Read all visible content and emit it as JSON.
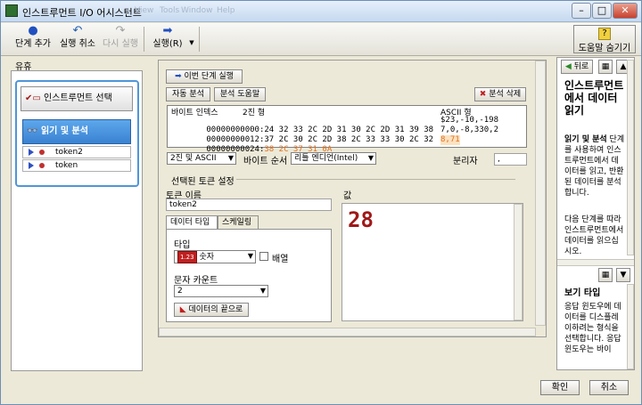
{
  "window": {
    "title": "인스트루먼트 I/O 어시스턴트",
    "ghost_menu": [
      "View",
      "Tools",
      "Window",
      "Help"
    ]
  },
  "toolbar": {
    "add_step": "단계 추가",
    "undo": "실행 취소",
    "redo": "다시 실행",
    "run": "실행(R)",
    "hide_help": "도움말 숨기기"
  },
  "left": {
    "label": "유휴",
    "step1": "인스트루먼트 선택",
    "step2": "읽기 및 분석",
    "tokens": [
      "token2",
      "token"
    ]
  },
  "main": {
    "run_prev": "이번 단계 실행",
    "auto_parse": "자동 분석",
    "parse_help": "분석 도움말",
    "delete_parse": "분석 삭제",
    "hex": {
      "col_index": "바이트 인덱스",
      "col_binary": "2진 형",
      "col_ascii": "ASCII 형",
      "rows": [
        {
          "index": "00000000000:",
          "hex": "24 32 33 2C 2D 31 30 2C 2D 31 39 38",
          "ascii": "$23,-10,-198"
        },
        {
          "index": "00000000012:",
          "hex": "37 2C 30 2C 2D 38 2C 33 33 30 2C 32",
          "ascii": "7,0,-8,330,2"
        },
        {
          "index": "00000000024:",
          "hex": "38 2C 37 31 0A",
          "ascii": "8,71"
        }
      ]
    },
    "display_mode": "2진 및 ASCII",
    "byte_order_label": "바이트 순서",
    "byte_order": "리틀 엔디언(Intel)",
    "separator_label": "분리자",
    "separator": ",",
    "group_label": "선택된 토큰 설정",
    "token_name_label": "토큰 이름",
    "token_name": "token2",
    "value_label": "값",
    "value": "28",
    "tab_data_type": "데이터 타입",
    "tab_scaling": "스케일링",
    "type_label": "타입",
    "type_icon_text": "1.23",
    "type_value": "숫자",
    "array_label": "배열",
    "char_count_label": "문자 카운트",
    "char_count": "2",
    "end_of_data": "데이터의 끝으로"
  },
  "right": {
    "back": "뒤로",
    "title": "인스트루먼트에서 데이터 읽기",
    "para1_bold": "읽기 및 분석",
    "para1": " 단계를 사용하여 인스트루먼트에서 데이터를 읽고, 반환된 데이터를 분석합니다.",
    "para2": "다음 단계를 따라 인스트루먼트에서 데이터를 읽으십시오.",
    "title2": "보기 타입",
    "para3": "응답 윈도우에 데이터를 디스플레이하려는 형식을 선택합니다. 응답 윈도우는 바이"
  },
  "footer": {
    "ok": "확인",
    "cancel": "취소"
  },
  "colors": {
    "accent": "#3a82d2",
    "value": "#a01818",
    "strike": "#e07020"
  }
}
